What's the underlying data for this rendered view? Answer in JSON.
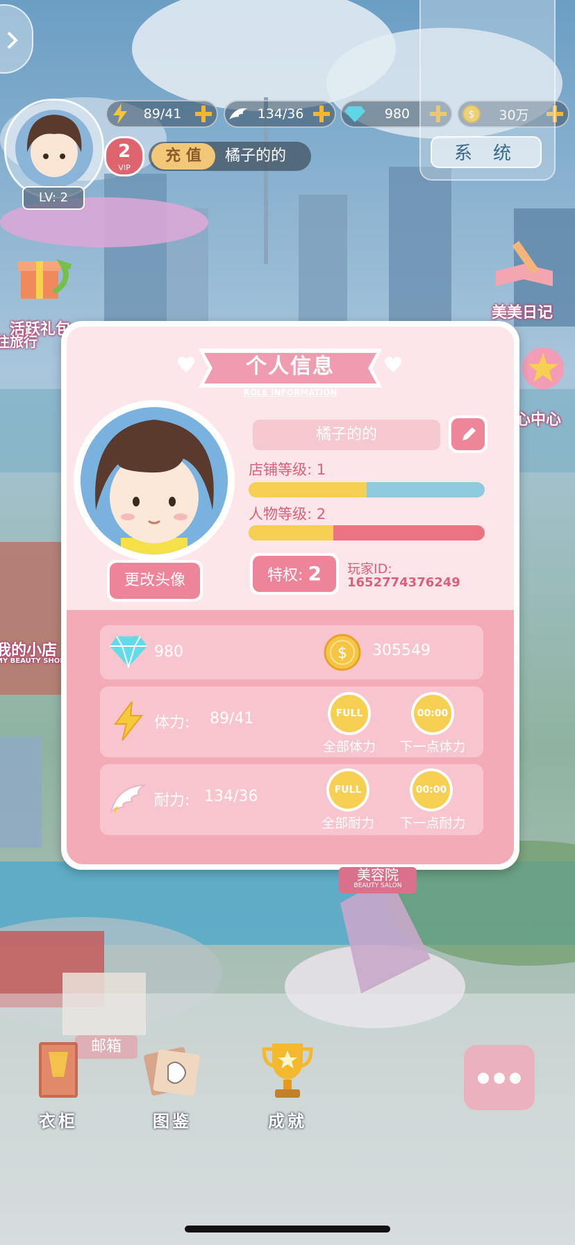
{
  "hud": {
    "stamina": "89/41",
    "endurance": "134/36",
    "diamonds": "980",
    "coins": "30万",
    "level": "LV: 2",
    "vip_level": "2",
    "vip_tag": "VIP",
    "recharge": "充 值",
    "player_name": "橘子的的",
    "system": "系统"
  },
  "side": {
    "activity_gift": "活跃礼包",
    "travel": "往旅行",
    "diary": "美美日记",
    "center": "心中心",
    "my_shop": "我的小店",
    "my_shop_en": "MY BEAUTY SHOP",
    "beauty_salon": "美容院",
    "beauty_salon_en": "BEAUTY SALON",
    "mailbox": "邮箱"
  },
  "modal": {
    "title": "个人信息",
    "subtitle": "ROLE INFORMATION",
    "name": "橘子的的",
    "change_avatar": "更改头像",
    "shop_level_label": "店铺等级: 1",
    "shop_level_progress": 0.5,
    "char_level_label": "人物等级: 2",
    "char_level_progress": 0.36,
    "privilege_label": "特权: ",
    "privilege_value": "2",
    "player_id_label": "玩家ID:",
    "player_id": "1652774376249",
    "diamonds": "980",
    "coins": "305549",
    "stamina_label": "体力:",
    "stamina_value": "89/41",
    "endurance_label": "耐力:",
    "endurance_value": "134/36",
    "full_text": "FULL",
    "timer_text": "00:00",
    "all_stamina": "全部体力",
    "next_stamina": "下一点体力",
    "all_endurance": "全部耐力",
    "next_endurance": "下一点耐力"
  },
  "nav": {
    "wardrobe": "衣柜",
    "catalog": "图鉴",
    "achievement": "成就"
  },
  "colors": {
    "modal_bg": "#fde6e9",
    "modal_lower": "#f3abb8",
    "accent_pink": "#ee8499",
    "gold": "#f6cf53",
    "bar_blue": "#8ec9de",
    "bar_red": "#ec7480"
  }
}
